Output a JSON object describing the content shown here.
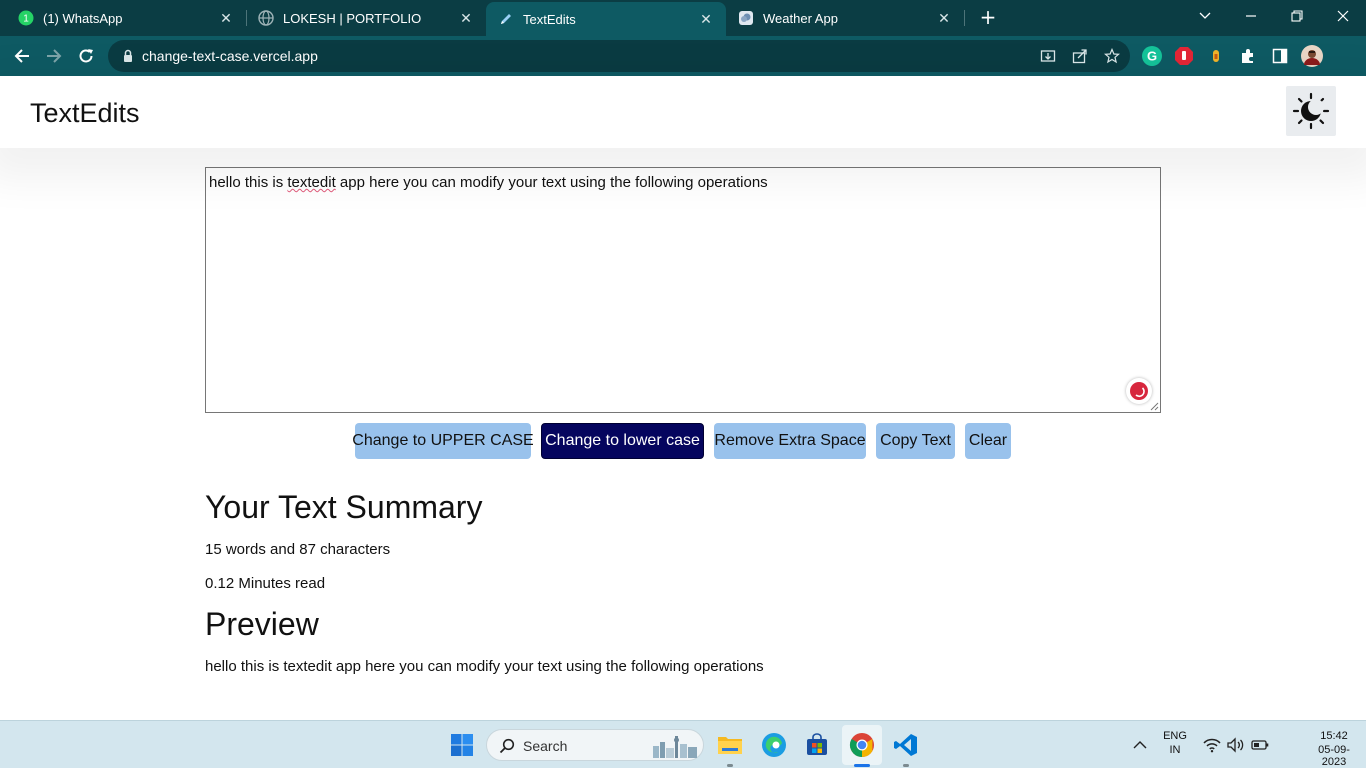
{
  "browser": {
    "tabs": [
      {
        "title": "(1) WhatsApp",
        "favicon": "whatsapp-icon",
        "active": false
      },
      {
        "title": "LOKESH | PORTFOLIO",
        "favicon": "globe-icon",
        "active": false
      },
      {
        "title": "TextEdits",
        "favicon": "pen-icon",
        "active": true
      },
      {
        "title": "Weather App",
        "favicon": "weather-icon",
        "active": false
      }
    ],
    "url": "change-text-case.vercel.app",
    "colors": {
      "frame": "#0b3d44",
      "toolbar": "#0e5a63",
      "omnibox": "#0a3b42"
    }
  },
  "app": {
    "brand": "TextEdits",
    "theme_toggle_icon": "moon-icon"
  },
  "editor": {
    "text_before": "hello this is ",
    "misspelled_word": "textedit",
    "text_after": " app here you can modify your text using the following operations"
  },
  "buttons": {
    "upper": "Change to UPPER CASE",
    "lower": "Change to lower case",
    "extra_space": "Remove Extra Space",
    "copy": "Copy Text",
    "clear": "Clear"
  },
  "summary": {
    "heading": "Your Text Summary",
    "counts": "15 words and 87 characters",
    "read_time": "0.12 Minutes read"
  },
  "preview": {
    "heading": "Preview",
    "text": "hello this is textedit app here you can modify your text using the following operations"
  },
  "taskbar": {
    "search_label": "Search",
    "language_top": "ENG",
    "language_bottom": "IN",
    "time": "15:42",
    "date": "05-09-2023"
  },
  "colors": {
    "button_light": "#99c2ec",
    "button_dark": "#05055e"
  }
}
